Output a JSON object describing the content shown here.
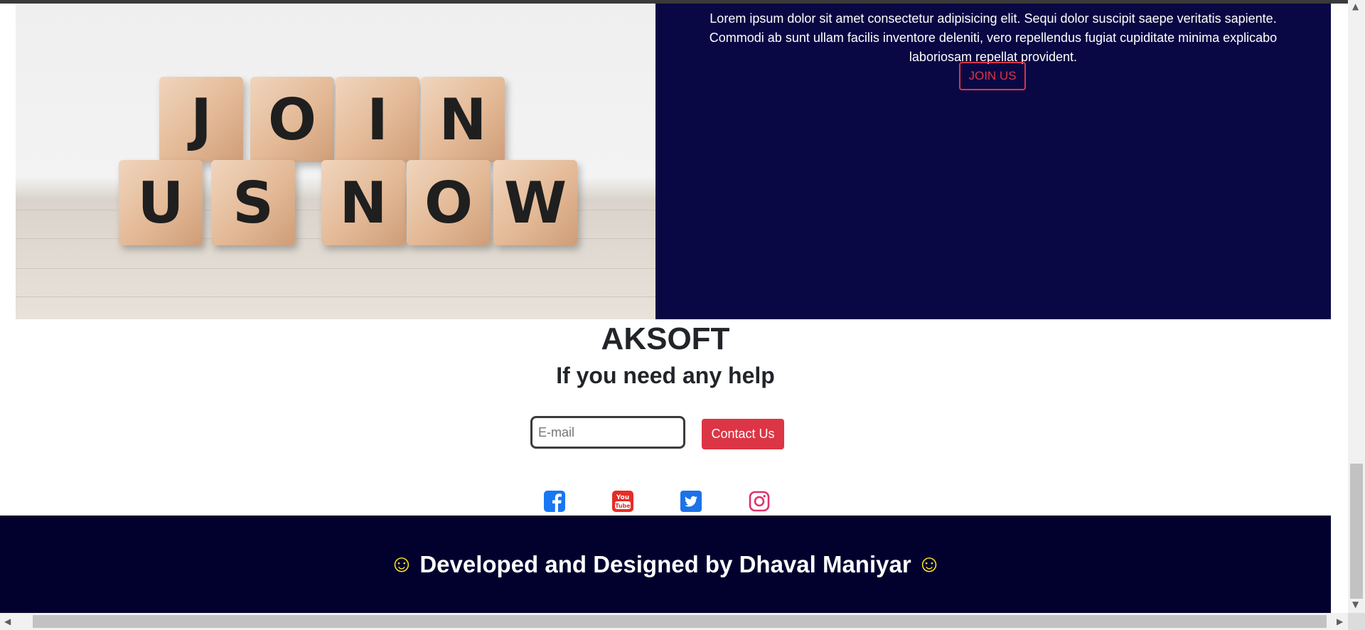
{
  "join_section": {
    "image_alt": "JOIN US NOW",
    "blocks_row1": [
      "J",
      "O",
      "I",
      "N"
    ],
    "blocks_row2": [
      "U",
      "S",
      "N",
      "O",
      "W"
    ],
    "paragraph": "Lorem ipsum dolor sit amet consectetur adipisicing elit. Sequi dolor suscipit saepe veritatis sapiente. Commodi ab sunt ullam facilis inventore deleniti, vero repellendus fugiat cupiditate minima explicabo laboriosam repellat provident.",
    "join_button": "JOIN US",
    "panel_color": "#0a0844"
  },
  "contact": {
    "brand": "AKSOFT",
    "help_text": "If you need any help",
    "email_placeholder": "E-mail",
    "contact_button": "Contact Us",
    "accent_color": "#dc3545"
  },
  "social": [
    {
      "name": "facebook-icon",
      "color": "#1877f2"
    },
    {
      "name": "youtube-icon",
      "color": "#e52d27"
    },
    {
      "name": "twitter-icon",
      "color": "#1d72e8"
    },
    {
      "name": "instagram-icon",
      "color": "#e1306c"
    }
  ],
  "footer": {
    "smile": "☺",
    "text": "Developed and Designed by Dhaval Maniyar",
    "background": "#02012e"
  }
}
